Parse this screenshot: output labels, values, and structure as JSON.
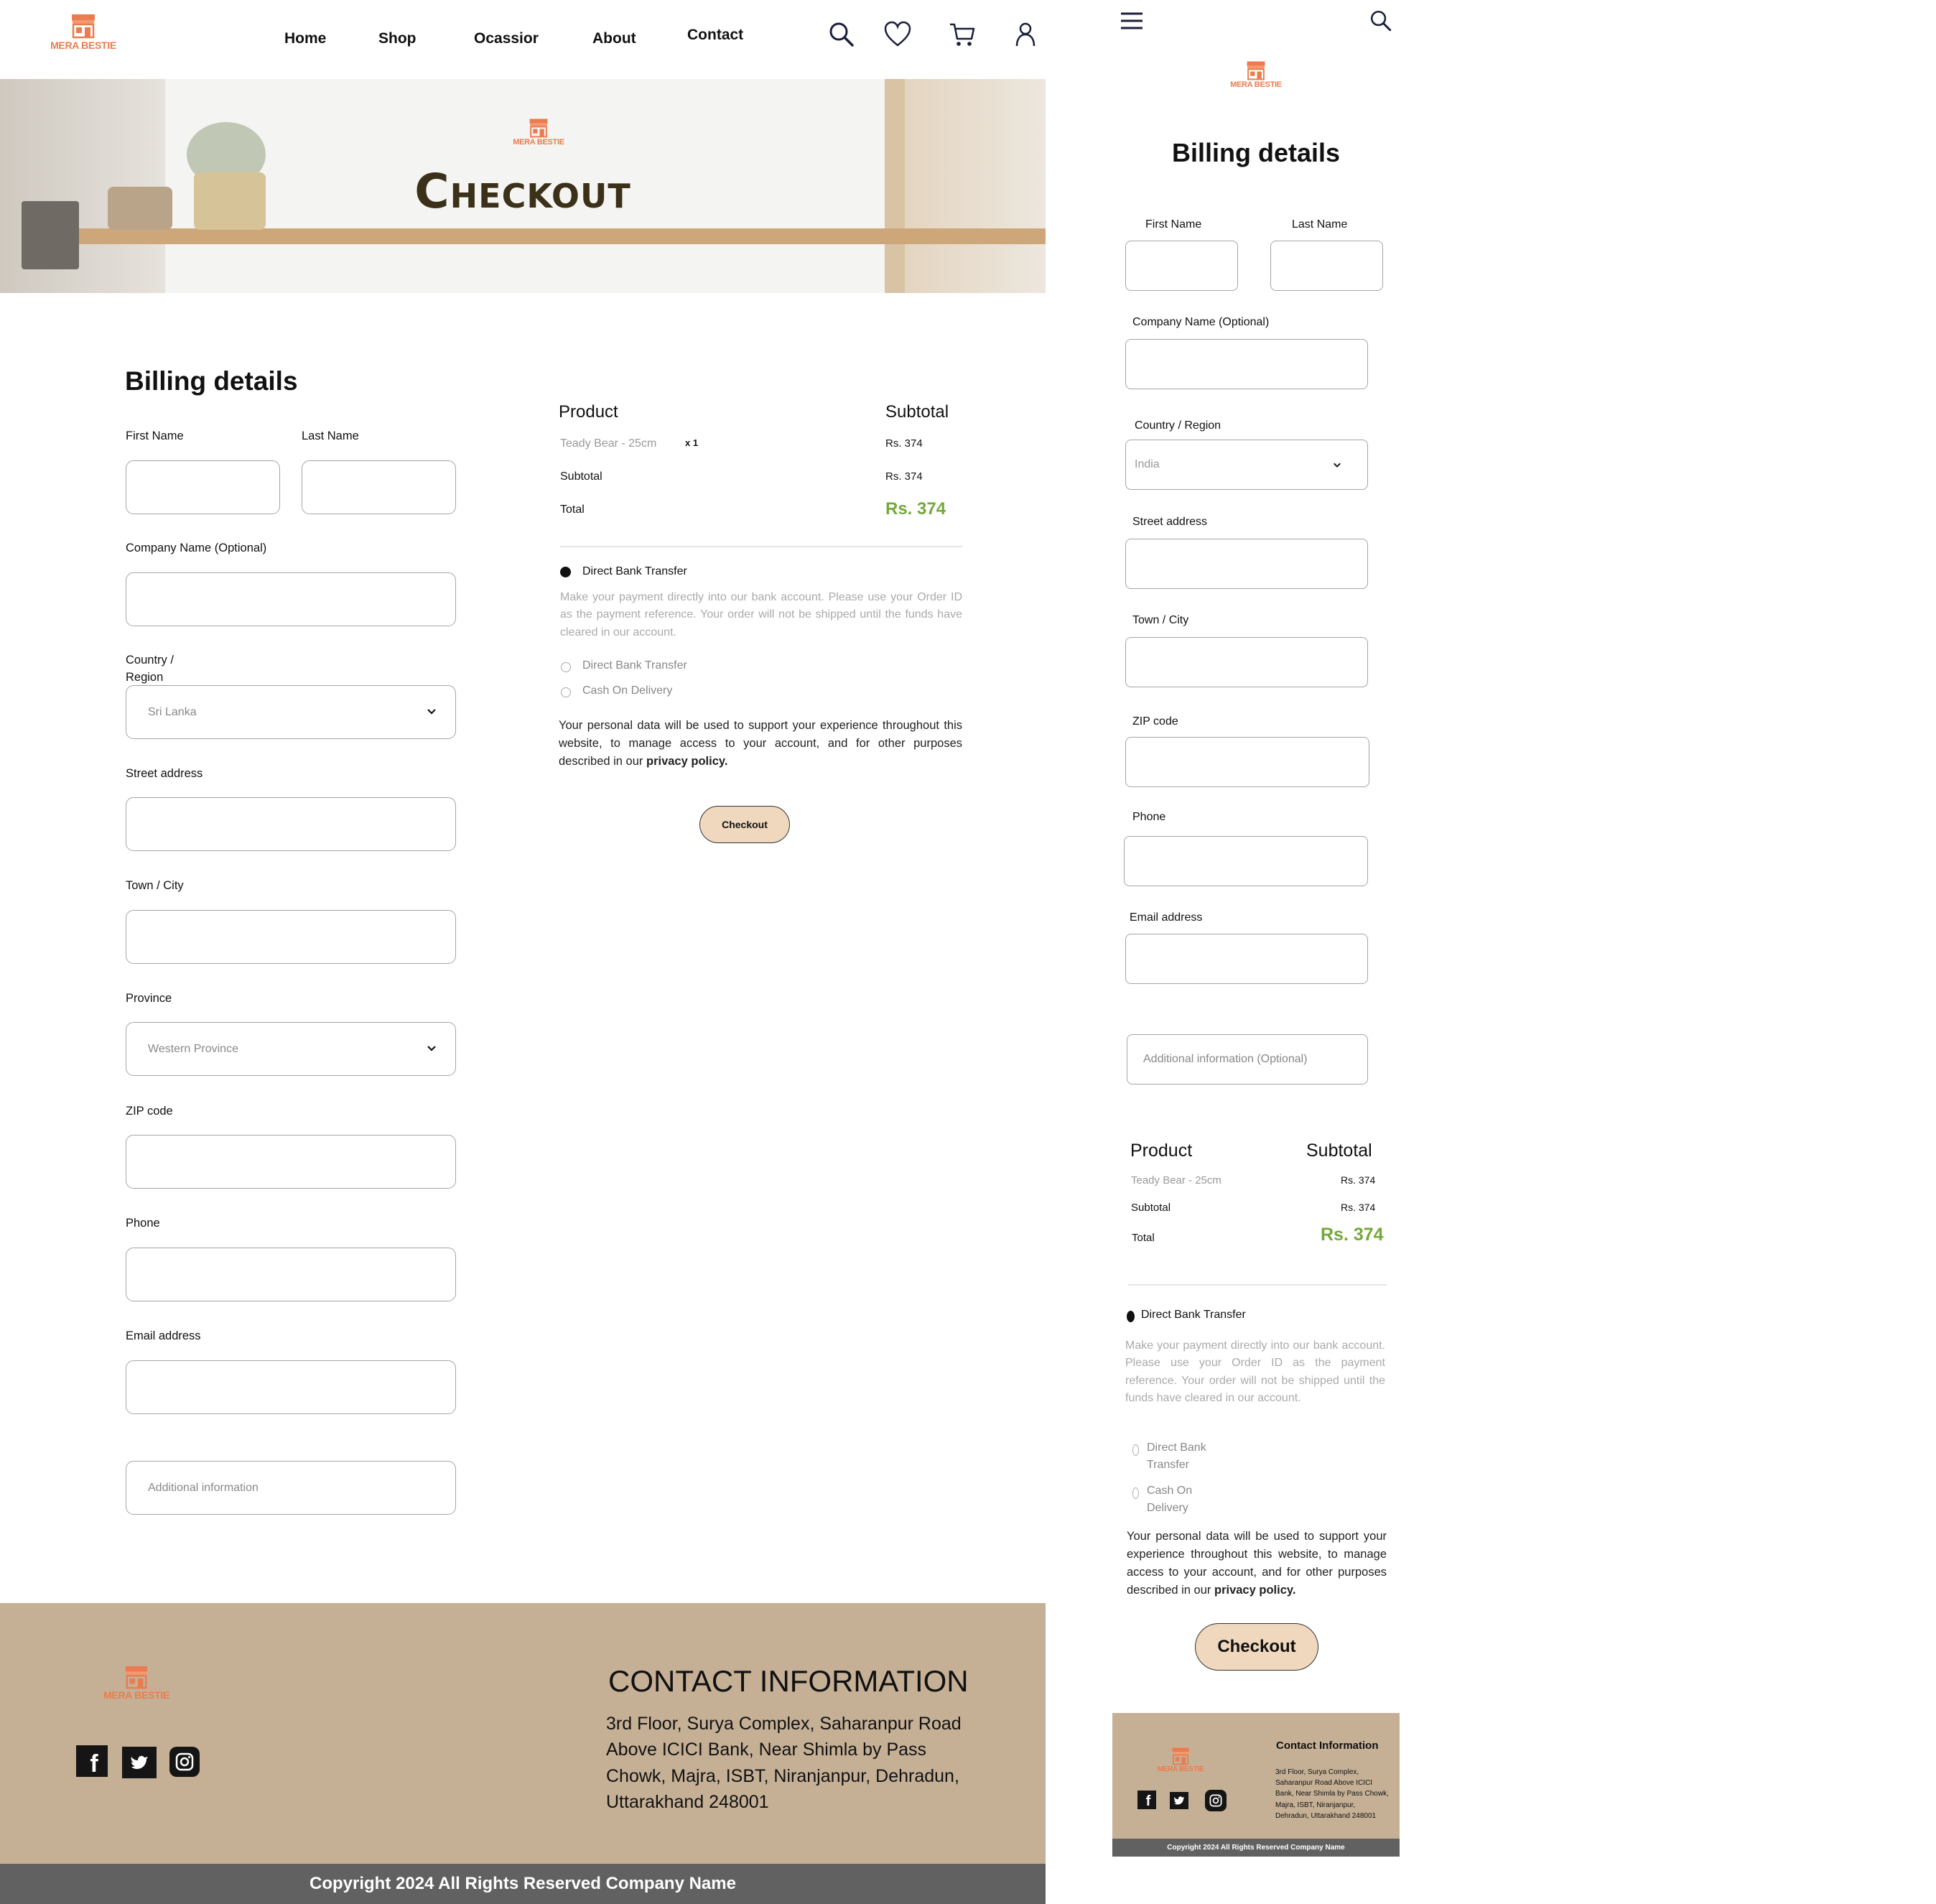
{
  "brand": {
    "name": "MERA BESTIE",
    "color": "#ea7c4f"
  },
  "nav": {
    "items": [
      {
        "label": "Home"
      },
      {
        "label": "Shop"
      },
      {
        "label": "Ocassior"
      },
      {
        "label": "About"
      },
      {
        "label": "Contact"
      }
    ],
    "icons": [
      "search-icon",
      "heart-icon",
      "cart-icon",
      "user-icon"
    ]
  },
  "hero": {
    "title": "Checkout"
  },
  "billing": {
    "title": "Billing details",
    "first_name_label": "First Name",
    "last_name_label": "Last Name",
    "company_label": "Company Name (Optional)",
    "country_label": "Country / Region",
    "country_value": "Sri Lanka",
    "street_label": "Street address",
    "town_label": "Town / City",
    "province_label": "Province",
    "province_value": "Western Province",
    "zip_label": "ZIP code",
    "phone_label": "Phone",
    "email_label": "Email address",
    "additional_placeholder": "Additional information"
  },
  "order": {
    "product_header": "Product",
    "subtotal_header": "Subtotal",
    "item_name": "Teady Bear - 25cm",
    "item_qty": "x 1",
    "item_price": "Rs. 374",
    "subtotal_label": "Subtotal",
    "subtotal_value": "Rs. 374",
    "total_label": "Total",
    "total_value": "Rs. 374",
    "total_color": "#74a83a"
  },
  "payment": {
    "selected_option": "Direct Bank Transfer",
    "description": "Make your payment directly into our bank account. Please use your Order ID as the payment reference. Your order will not be shipped until the funds have cleared in our account.",
    "options": [
      {
        "label": "Direct Bank Transfer"
      },
      {
        "label": "Cash On Delivery"
      }
    ],
    "privacy_text": "Your personal data will be used to support your experience throughout this website, to manage access to your account, and for other purposes described in our",
    "privacy_link": "privacy policy.",
    "checkout_label": "Checkout"
  },
  "footer": {
    "contact_title": "CONTACT INFORMATION",
    "address_lines": [
      "3rd Floor, Surya Complex, Saharanpur Road",
      "Above ICICI Bank, Near Shimla by Pass",
      "Chowk, Majra, ISBT, Niranjanpur, Dehradun,",
      "Uttarakhand 248001"
    ],
    "social_icons": [
      "facebook-icon",
      "twitter-icon",
      "instagram-icon"
    ],
    "copyright": "Copyright 2024 All Rights Reserved Company Name",
    "bg_color": "#c5b096",
    "copy_bg_color": "#616161"
  },
  "mobile": {
    "country_label": "Country / Region",
    "country_value": "India",
    "additional_placeholder": "Additional information (Optional)",
    "payment_option_lines": [
      [
        "Direct Bank",
        "Transfer"
      ],
      [
        "Cash On",
        "Delivery"
      ]
    ],
    "privacy_tail": "policy.",
    "privacy_link": "privacy",
    "contact_title": "Contact Information",
    "address_lines": [
      "3rd Floor, Surya Complex,",
      "Saharanpur Road Above ICICI",
      "Bank, Near Shimla by Pass Chowk,",
      "Majra, ISBT, Niranjanpur,",
      "Dehradun, Uttarakhand 248001"
    ]
  }
}
